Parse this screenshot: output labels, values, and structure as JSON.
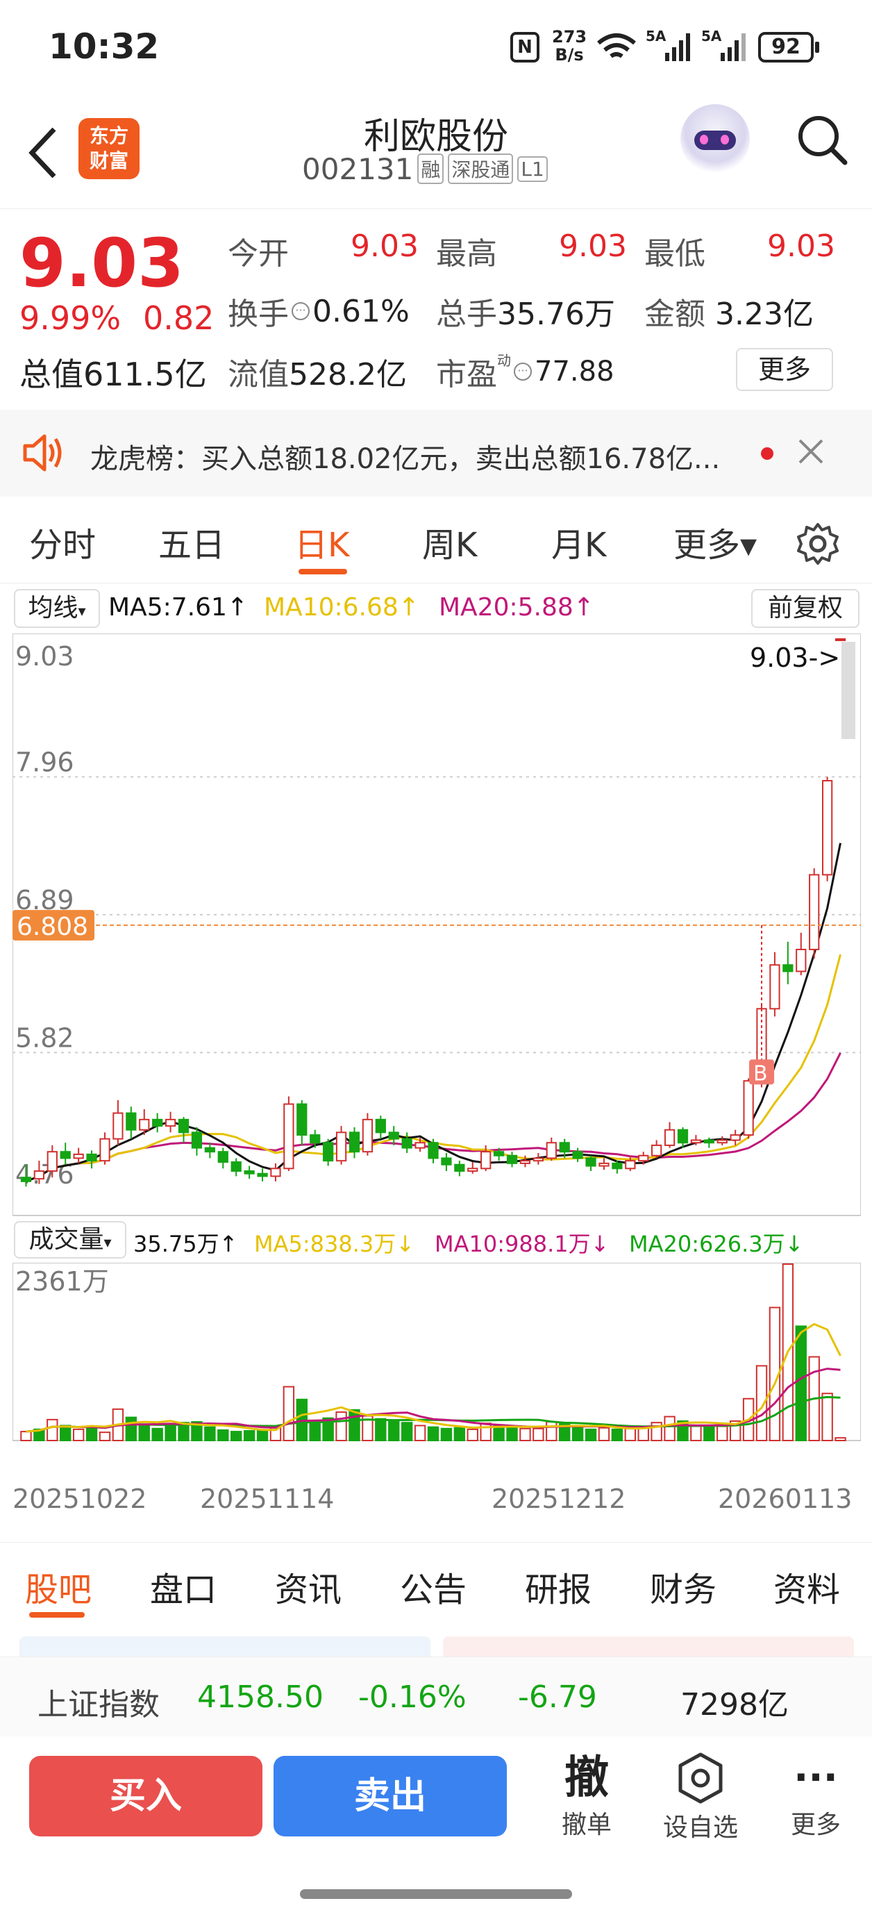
{
  "status": {
    "time": "10:32",
    "net_speed_top": "273",
    "net_speed_bottom": "B/s",
    "signal1": "5A",
    "signal2": "5A",
    "battery": "92"
  },
  "header": {
    "logo_top": "东方",
    "logo_bottom": "财富",
    "name": "利欧股份",
    "code": "002131",
    "tags": [
      "融",
      "深股通",
      "L1"
    ]
  },
  "quote": {
    "price": "9.03",
    "pct": "9.99%",
    "change": "0.82",
    "open_label": "今开",
    "open": "9.03",
    "high_label": "最高",
    "high": "9.03",
    "low_label": "最低",
    "low": "9.03",
    "turnover_label": "换手",
    "turnover": "0.61%",
    "volume_label": "总手",
    "volume": "35.76万",
    "amount_label": "金额",
    "amount": "3.23亿",
    "mktcap_label": "总值",
    "mktcap": "611.5亿",
    "float_label": "流值",
    "float": "528.2亿",
    "pe_label": "市盈",
    "pe_sup": "动",
    "pe": "77.88",
    "more": "更多"
  },
  "ticker": {
    "text": "龙虎榜：买入总额18.02亿元，卖出总额16.78亿..."
  },
  "ktabs": [
    "分时",
    "五日",
    "日K",
    "周K",
    "月K",
    "更多▾"
  ],
  "active_tab": "日K",
  "ma_bar": {
    "label": "均线",
    "ma5": "MA5:7.61↑",
    "ma10": "MA10:6.68↑",
    "ma20": "MA20:5.88↑",
    "adjust": "前复权"
  },
  "price_chart": {
    "y_labels": [
      "9.03",
      "7.96",
      "6.89",
      "5.82",
      "4.76"
    ],
    "last_price_label": "9.03->",
    "crosshair_label": "6.808",
    "buy_marker": "B"
  },
  "vol_bar": {
    "label": "成交量",
    "vol": "35.75万↑",
    "ma5": "MA5:838.3万↓",
    "ma10": "MA10:988.1万↓",
    "ma20": "MA20:626.3万↓",
    "max_label": "2361万"
  },
  "dates": [
    "20251022",
    "20251114",
    "20251212",
    "20260113"
  ],
  "chart_data": {
    "type": "candlestick",
    "ylim": [
      4.76,
      9.03
    ],
    "candles": [
      [
        4.85,
        4.82,
        4.95,
        4.78
      ],
      [
        4.84,
        4.9,
        4.98,
        4.8
      ],
      [
        4.9,
        5.05,
        5.1,
        4.85
      ],
      [
        5.05,
        5.0,
        5.12,
        4.95
      ],
      [
        5.0,
        5.03,
        5.08,
        4.96
      ],
      [
        5.03,
        4.98,
        5.06,
        4.92
      ],
      [
        4.98,
        5.15,
        5.2,
        4.95
      ],
      [
        5.15,
        5.35,
        5.45,
        5.1
      ],
      [
        5.35,
        5.22,
        5.4,
        5.15
      ],
      [
        5.22,
        5.3,
        5.38,
        5.18
      ],
      [
        5.3,
        5.25,
        5.35,
        5.2
      ],
      [
        5.25,
        5.3,
        5.36,
        5.2
      ],
      [
        5.3,
        5.2,
        5.32,
        5.12
      ],
      [
        5.2,
        5.08,
        5.24,
        5.02
      ],
      [
        5.08,
        5.05,
        5.12,
        5.0
      ],
      [
        5.05,
        4.97,
        5.08,
        4.92
      ],
      [
        4.97,
        4.9,
        5.0,
        4.86
      ],
      [
        4.9,
        4.88,
        4.94,
        4.84
      ],
      [
        4.88,
        4.86,
        4.92,
        4.82
      ],
      [
        4.86,
        4.92,
        4.96,
        4.82
      ],
      [
        4.92,
        5.42,
        5.48,
        4.9
      ],
      [
        5.42,
        5.18,
        5.45,
        5.1
      ],
      [
        5.18,
        5.12,
        5.22,
        5.08
      ],
      [
        5.12,
        4.98,
        5.15,
        4.94
      ],
      [
        4.98,
        5.2,
        5.25,
        4.95
      ],
      [
        5.2,
        5.05,
        5.24,
        5.0
      ],
      [
        5.05,
        5.3,
        5.35,
        5.02
      ],
      [
        5.3,
        5.2,
        5.33,
        5.15
      ],
      [
        5.2,
        5.15,
        5.25,
        5.1
      ],
      [
        5.15,
        5.08,
        5.2,
        5.04
      ],
      [
        5.08,
        5.12,
        5.16,
        5.05
      ],
      [
        5.12,
        5.0,
        5.15,
        4.96
      ],
      [
        5.0,
        4.95,
        5.04,
        4.9
      ],
      [
        4.95,
        4.9,
        4.98,
        4.86
      ],
      [
        4.9,
        4.92,
        4.97,
        4.88
      ],
      [
        4.92,
        5.05,
        5.1,
        4.9
      ],
      [
        5.05,
        5.02,
        5.08,
        4.98
      ],
      [
        5.02,
        4.96,
        5.05,
        4.93
      ],
      [
        4.96,
        4.98,
        5.02,
        4.93
      ],
      [
        4.98,
        5.0,
        5.04,
        4.95
      ],
      [
        5.0,
        5.12,
        5.16,
        4.98
      ],
      [
        5.12,
        5.05,
        5.15,
        5.0
      ],
      [
        5.05,
        5.0,
        5.08,
        4.97
      ],
      [
        5.0,
        4.94,
        5.02,
        4.9
      ],
      [
        4.94,
        4.96,
        5.0,
        4.91
      ],
      [
        4.96,
        4.92,
        4.98,
        4.88
      ],
      [
        4.92,
        4.98,
        5.02,
        4.9
      ],
      [
        4.98,
        5.02,
        5.05,
        4.95
      ],
      [
        5.02,
        5.1,
        5.14,
        5.0
      ],
      [
        5.1,
        5.22,
        5.28,
        5.08
      ],
      [
        5.22,
        5.12,
        5.24,
        5.08
      ],
      [
        5.12,
        5.14,
        5.18,
        5.1
      ],
      [
        5.14,
        5.12,
        5.16,
        5.08
      ],
      [
        5.12,
        5.14,
        5.17,
        5.1
      ],
      [
        5.14,
        5.18,
        5.22,
        5.1
      ],
      [
        5.18,
        5.6,
        5.62,
        5.15
      ],
      [
        5.6,
        6.16,
        6.2,
        5.55
      ],
      [
        6.16,
        6.5,
        6.6,
        6.1
      ],
      [
        6.5,
        6.45,
        6.68,
        6.35
      ],
      [
        6.45,
        6.62,
        6.75,
        6.42
      ],
      [
        6.62,
        7.2,
        7.25,
        6.55
      ],
      [
        7.2,
        7.93,
        7.96,
        7.15
      ],
      [
        9.03,
        9.03,
        9.03,
        9.03
      ]
    ],
    "volumes": [
      120,
      150,
      280,
      200,
      150,
      190,
      110,
      420,
      310,
      220,
      160,
      200,
      240,
      250,
      180,
      140,
      120,
      130,
      140,
      170,
      720,
      550,
      270,
      300,
      380,
      410,
      330,
      290,
      260,
      240,
      200,
      180,
      160,
      170,
      150,
      230,
      210,
      170,
      160,
      160,
      250,
      230,
      180,
      150,
      170,
      150,
      160,
      190,
      240,
      320,
      260,
      200,
      180,
      190,
      260,
      560,
      1000,
      1780,
      2361,
      1530,
      1120,
      630,
      35.75
    ],
    "vol_green": [
      false,
      true,
      false,
      true,
      false,
      true,
      false,
      false,
      true,
      true,
      true,
      true,
      true,
      true,
      true,
      true,
      true,
      true,
      true,
      false,
      false,
      true,
      true,
      true,
      false,
      true,
      false,
      true,
      true,
      true,
      false,
      true,
      true,
      true,
      false,
      false,
      true,
      true,
      false,
      false,
      false,
      true,
      true,
      true,
      false,
      true,
      false,
      false,
      false,
      false,
      true,
      false,
      true,
      false,
      false,
      false,
      false,
      false,
      false,
      true,
      false,
      false,
      false
    ],
    "vol_ylim": [
      0,
      2361
    ]
  },
  "bottom_tabs": [
    "股吧",
    "盘口",
    "资讯",
    "公告",
    "研报",
    "财务",
    "资料"
  ],
  "index": {
    "name": "上证指数",
    "value": "4158.50",
    "pct": "-0.16%",
    "change": "-6.79",
    "amount": "7298亿"
  },
  "actions": {
    "buy": "买入",
    "sell": "卖出",
    "cancel_icon": "撤",
    "cancel": "撤单",
    "watch": "设自选",
    "more": "更多"
  }
}
